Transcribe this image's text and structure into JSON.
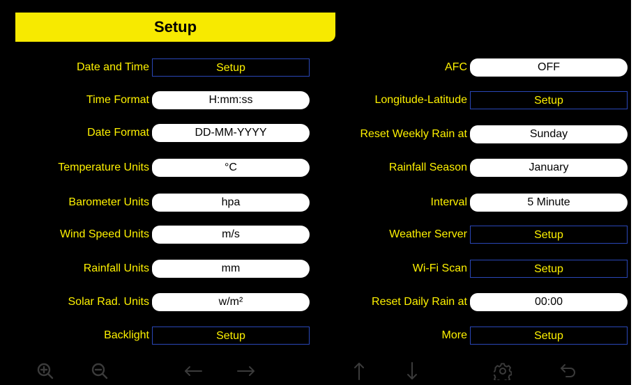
{
  "header": {
    "title": "Setup"
  },
  "left_rows": [
    {
      "label": "Date and Time",
      "value": "Setup",
      "kind": "button"
    },
    {
      "label": "Time Format",
      "value": "H:mm:ss",
      "kind": "value"
    },
    {
      "label": "Date Format",
      "value": "DD-MM-YYYY",
      "kind": "value"
    },
    {
      "label": "Temperature Units",
      "value": "°C",
      "kind": "value"
    },
    {
      "label": "Barometer Units",
      "value": "hpa",
      "kind": "value"
    },
    {
      "label": "Wind Speed Units",
      "value": "m/s",
      "kind": "value"
    },
    {
      "label": "Rainfall Units",
      "value": "mm",
      "kind": "value"
    },
    {
      "label": "Solar Rad. Units",
      "value": "w/m²",
      "kind": "value"
    },
    {
      "label": "Backlight",
      "value": "Setup",
      "kind": "button"
    }
  ],
  "right_rows": [
    {
      "label": "AFC",
      "value": "OFF",
      "kind": "value"
    },
    {
      "label": "Longitude-Latitude",
      "value": "Setup",
      "kind": "button"
    },
    {
      "label": "Reset Weekly Rain at",
      "value": "Sunday",
      "kind": "value"
    },
    {
      "label": "Rainfall Season",
      "value": "January",
      "kind": "value"
    },
    {
      "label": "Interval",
      "value": "5 Minute",
      "kind": "value"
    },
    {
      "label": "Weather Server",
      "value": "Setup",
      "kind": "button"
    },
    {
      "label": "Wi-Fi Scan",
      "value": "Setup",
      "kind": "button"
    },
    {
      "label": "Reset Daily Rain at",
      "value": "00:00",
      "kind": "value"
    },
    {
      "label": "More",
      "value": "Setup",
      "kind": "button"
    }
  ],
  "toolbar": {
    "icons": [
      "zoom-in-icon",
      "zoom-out-icon",
      "arrow-left-icon",
      "arrow-right-icon",
      "arrow-up-icon",
      "arrow-down-icon",
      "gear-icon",
      "back-icon"
    ]
  },
  "colors": {
    "background": "#000000",
    "header": "#f7ea00",
    "label_text": "#fff200",
    "button_border": "#2a47b8",
    "pill_background": "#ffffff",
    "toolbar_icons": "#3b3b3b"
  }
}
